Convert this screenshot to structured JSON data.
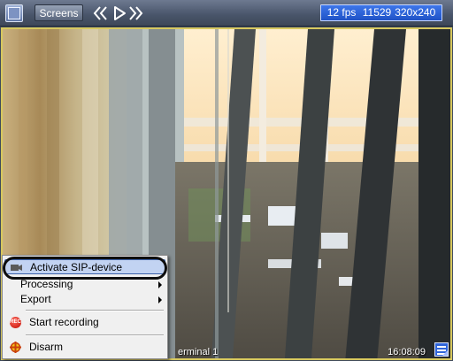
{
  "toolbar": {
    "screens_label": "Screens",
    "layout_icon": "layout-grid-icon",
    "nav_icons": [
      "rewind-icon",
      "play-icon",
      "fast-forward-icon"
    ],
    "stats": {
      "fps": "12 fps",
      "counter": "11529",
      "resolution": "320x240"
    }
  },
  "video": {
    "camera_label": "erminal 1",
    "timestamp": "16:08:09",
    "frame_color": "#d7c85e"
  },
  "context_menu": {
    "items": [
      {
        "label": "Activate SIP-device",
        "icon": "camera-icon",
        "highlighted": true
      },
      {
        "label": "Processing",
        "submenu": true
      },
      {
        "label": "Export",
        "submenu": true
      },
      {
        "label": "Start recording",
        "icon": "record-icon"
      },
      {
        "label": "Disarm",
        "icon": "disarm-icon"
      }
    ],
    "record_icon_text": "REC"
  },
  "colors": {
    "accent": "#2f64d9",
    "toolbar": "#485469"
  }
}
